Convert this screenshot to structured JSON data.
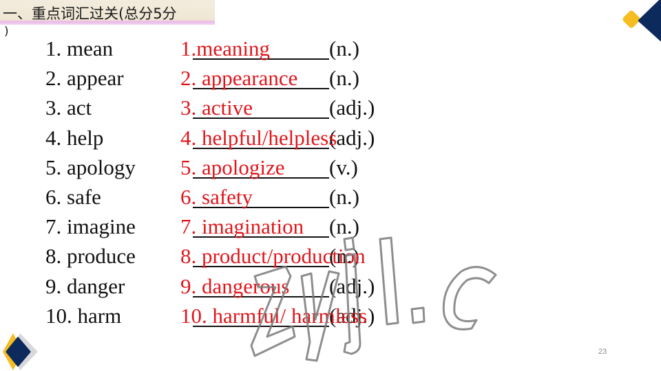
{
  "slide": {
    "title": "一、重点词汇过关(总分5分",
    "title_continuation": ")",
    "page_number": "23",
    "colors": {
      "answer": "#e0161b",
      "text": "#111111",
      "navy": "#0d2a5c",
      "gold": "#f5bd1f"
    }
  },
  "exercises": [
    {
      "word": "1. mean",
      "answer": "1.meaning",
      "pos": "(n.)"
    },
    {
      "word": "2. appear",
      "answer": "2. appearance",
      "pos": "(n.)"
    },
    {
      "word": "3. act",
      "answer": "3. active",
      "pos": "(adj.)"
    },
    {
      "word": "4. help",
      "answer": "4. helpful/helpless",
      "pos": "(adj.)"
    },
    {
      "word": "5. apology",
      "answer": "5. apologize",
      "pos": "(v.)"
    },
    {
      "word": "6. safe",
      "answer": "6. safety",
      "pos": "(n.)"
    },
    {
      "word": "7. imagine",
      "answer": "7. imagination",
      "pos": "(n.)"
    },
    {
      "word": "8. produce",
      "answer": "8. product/production",
      "pos": "(n.)"
    },
    {
      "word": "9. danger",
      "answer": "9. dangerous",
      "pos": "(adj.)"
    },
    {
      "word": "10. harm",
      "answer": "10. harmful/ harmless",
      "pos": "(adj.)"
    }
  ],
  "watermark": {
    "text": "zyjl.cn"
  }
}
